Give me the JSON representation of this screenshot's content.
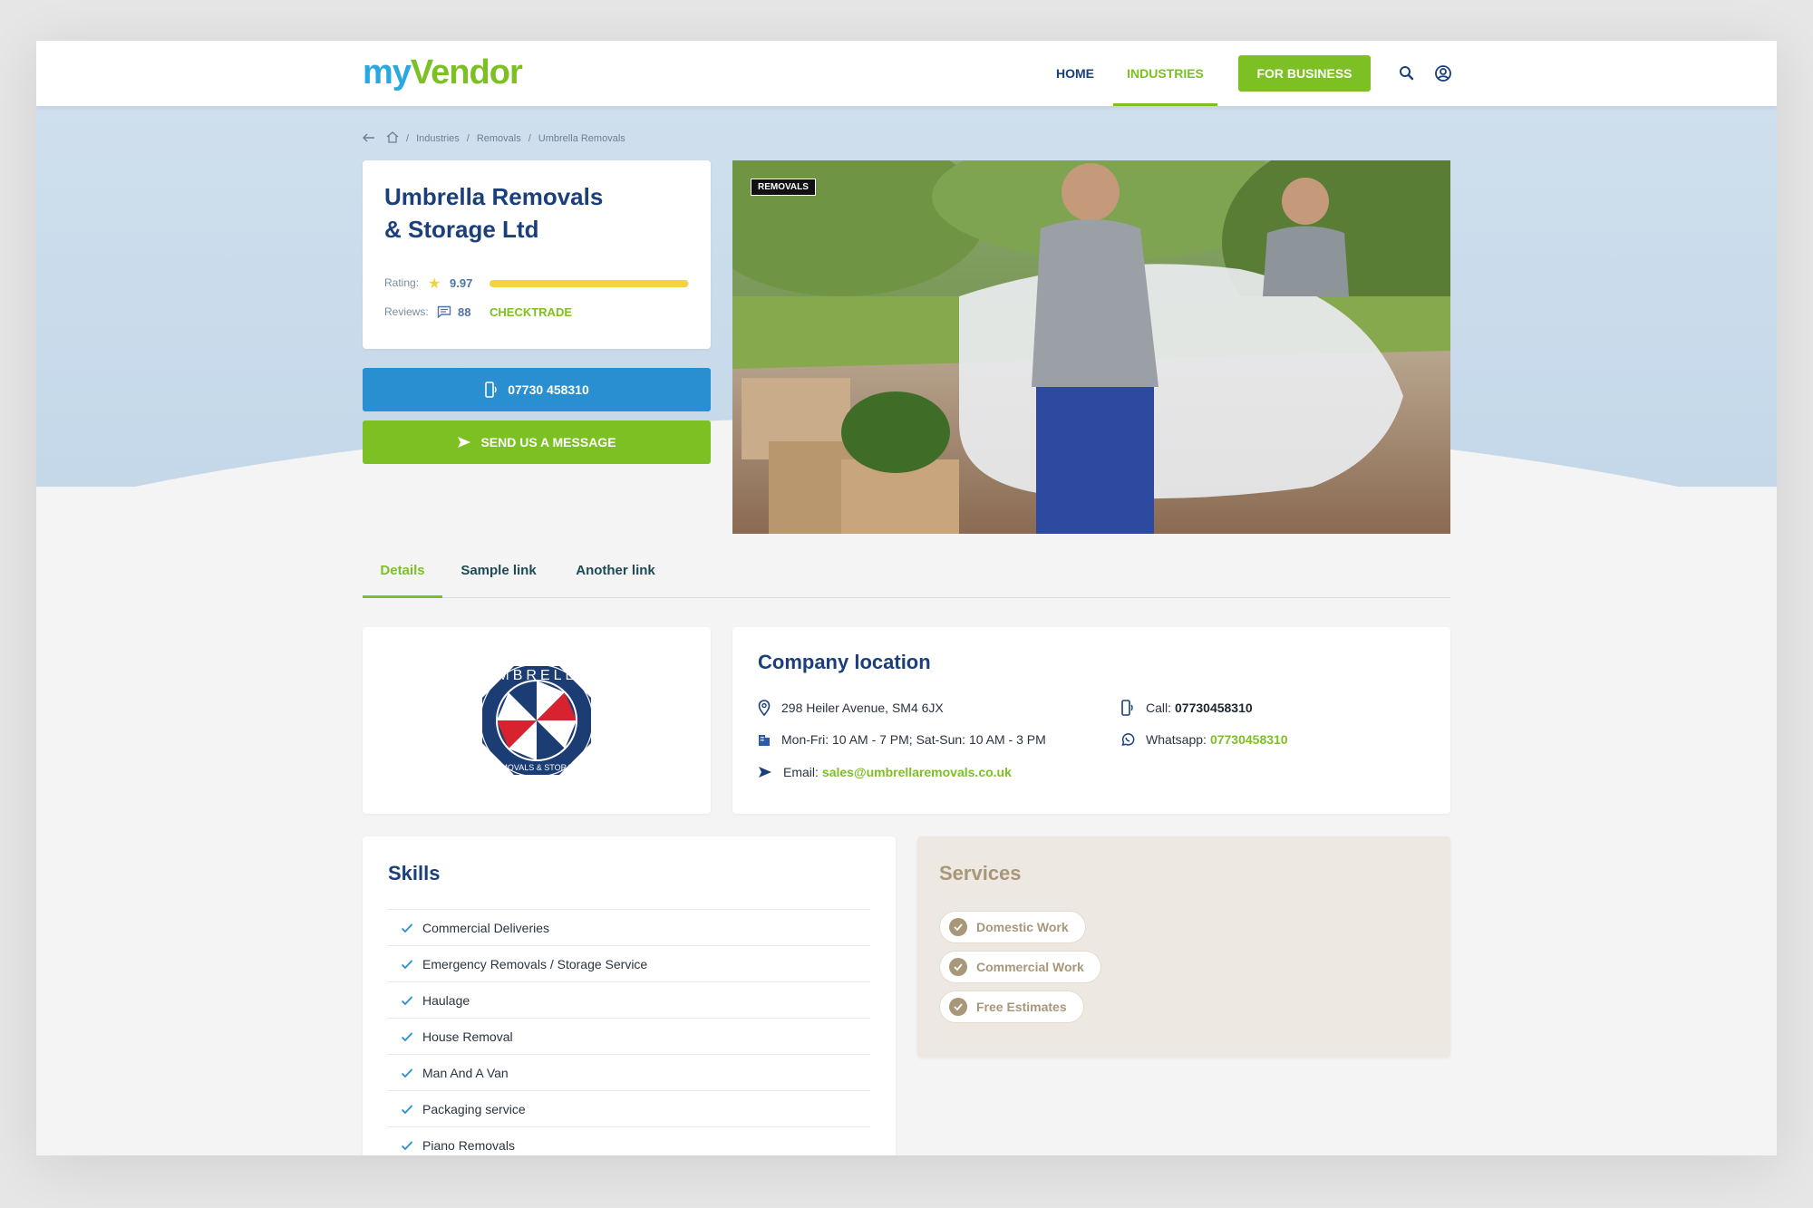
{
  "brand": {
    "part1": "my",
    "part2": "Vendor"
  },
  "nav": {
    "home": "HOME",
    "industries": "INDUSTRIES",
    "for_business": "FOR BUSINESS"
  },
  "breadcrumb": {
    "items": [
      "Industries",
      "Removals",
      "Umbrella Removals"
    ]
  },
  "company": {
    "name_line1": "Umbrella Removals",
    "name_line2": "& Storage Ltd",
    "rating_label": "Rating:",
    "rating_value": "9.97",
    "rating_fraction": 0.997,
    "reviews_label": "Reviews:",
    "reviews_count": "88",
    "reviews_source": "CHECKTRADE"
  },
  "actions": {
    "call": "07730 458310",
    "message": "SEND US A MESSAGE"
  },
  "hero": {
    "badge": "REMOVALS"
  },
  "tabs": [
    "Details",
    "Sample link",
    "Another link"
  ],
  "location": {
    "title": "Company location",
    "address": "298 Heiler Avenue, SM4 6JX",
    "hours": "Mon-Fri: 10 AM - 7 PM; Sat-Sun: 10 AM - 3 PM",
    "email_label": "Email:",
    "email": "sales@umbrellaremovals.co.uk",
    "call_label": "Call:",
    "call": "07730458310",
    "whatsapp_label": "Whatsapp:",
    "whatsapp": "07730458310"
  },
  "company_logo": {
    "top_text": "UMBRELLA",
    "bottom_text": "REMOVALS & STORAGE"
  },
  "skills": {
    "title": "Skills",
    "items": [
      "Commercial Deliveries",
      "Emergency Removals / Storage Service",
      "Haulage",
      "House Removal",
      "Man And A Van",
      "Packaging service",
      "Piano Removals"
    ]
  },
  "services": {
    "title": "Services",
    "items": [
      "Domestic Work",
      "Commercial Work",
      "Free Estimates"
    ]
  },
  "colors": {
    "brand_blue": "#1a3f7a",
    "accent_green": "#7dc023",
    "call_blue": "#2a8fd1",
    "rating_yellow": "#f2d43f",
    "services_tan": "#a89779"
  }
}
